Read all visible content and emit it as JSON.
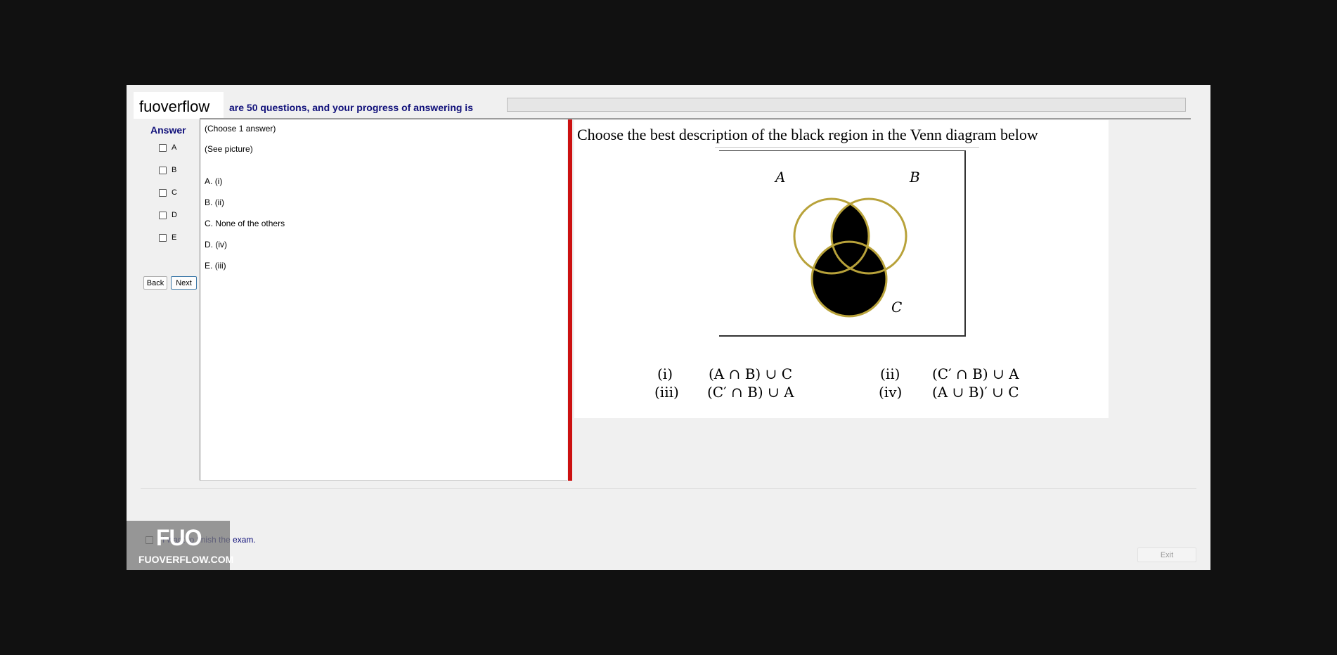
{
  "header": {
    "logo": "fuoverflow",
    "progress_text": "are 50 questions, and your progress of answering is",
    "progress_fraction": 0
  },
  "answer_panel": {
    "title": "Answer",
    "options": [
      "A",
      "B",
      "C",
      "D",
      "E"
    ],
    "back_label": "Back",
    "next_label": "Next"
  },
  "question": {
    "instruction": "(Choose 1 answer)",
    "see_picture": "(See picture)",
    "choices": [
      {
        "letter": "A.",
        "text": "(i)"
      },
      {
        "letter": "B.",
        "text": "(ii)"
      },
      {
        "letter": "C.",
        "text": "None of the others"
      },
      {
        "letter": "D.",
        "text": "(iv)"
      },
      {
        "letter": "E.",
        "text": "(iii)"
      }
    ]
  },
  "picture": {
    "title": "Choose the best description of the black region in the Venn diagram below",
    "venn_labels": {
      "a": "A",
      "b": "B",
      "c": "C"
    },
    "formulas": [
      {
        "num": "(i)",
        "expr": "(A ∩ B) ∪ C"
      },
      {
        "num": "(ii)",
        "expr": "(C′ ∩ B) ∪ A"
      },
      {
        "num": "(iii)",
        "expr": "(C′ ∩ B) ∪ A"
      },
      {
        "num": "(iv)",
        "expr": "(A ∪ B)′ ∪ C"
      }
    ]
  },
  "footer": {
    "finish_text": "I want to finish the exam.",
    "exit_label": "Exit"
  },
  "watermark": {
    "logo": "FUO",
    "site": "FUOVERFLOW.COM"
  },
  "colors": {
    "accent_text": "#10107a",
    "red_divider": "#cc1111",
    "circle_outline": "#b8a23a"
  }
}
